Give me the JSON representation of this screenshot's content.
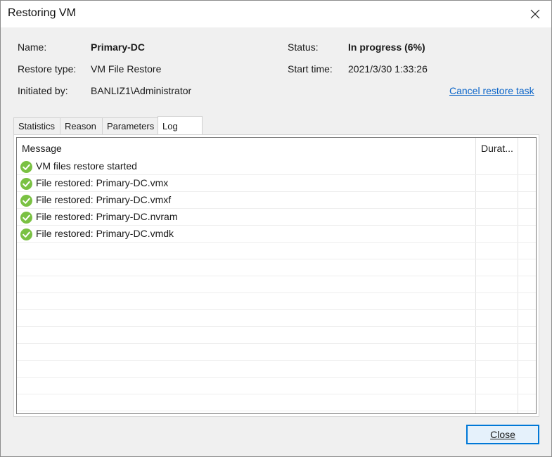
{
  "window": {
    "title": "Restoring VM"
  },
  "info": {
    "name_label": "Name:",
    "name_value": "Primary-DC",
    "restore_type_label": "Restore type:",
    "restore_type_value": "VM File Restore",
    "initiated_by_label": "Initiated by:",
    "initiated_by_value": "BANLIZ1\\Administrator",
    "status_label": "Status:",
    "status_value": "In progress (6%)",
    "start_time_label": "Start time:",
    "start_time_value": "2021/3/30 1:33:26",
    "cancel_link": "Cancel restore task"
  },
  "tabs": [
    {
      "label": "Statistics",
      "active": false
    },
    {
      "label": "Reason",
      "active": false
    },
    {
      "label": "Parameters",
      "active": false
    },
    {
      "label": "Log",
      "active": true
    }
  ],
  "log": {
    "columns": {
      "message": "Message",
      "duration": "Durat..."
    },
    "rows": [
      {
        "icon": "success-check-icon",
        "message": "VM files restore started"
      },
      {
        "icon": "success-check-icon",
        "message": "File restored: Primary-DC.vmx"
      },
      {
        "icon": "success-check-icon",
        "message": "File restored: Primary-DC.vmxf"
      },
      {
        "icon": "success-check-icon",
        "message": "File restored: Primary-DC.nvram"
      },
      {
        "icon": "success-check-icon",
        "message": "File restored: Primary-DC.vmdk"
      }
    ]
  },
  "footer": {
    "close_label": "Close"
  },
  "colors": {
    "success": "#7ac143",
    "link": "#0a64c8",
    "focus": "#0078d7"
  }
}
